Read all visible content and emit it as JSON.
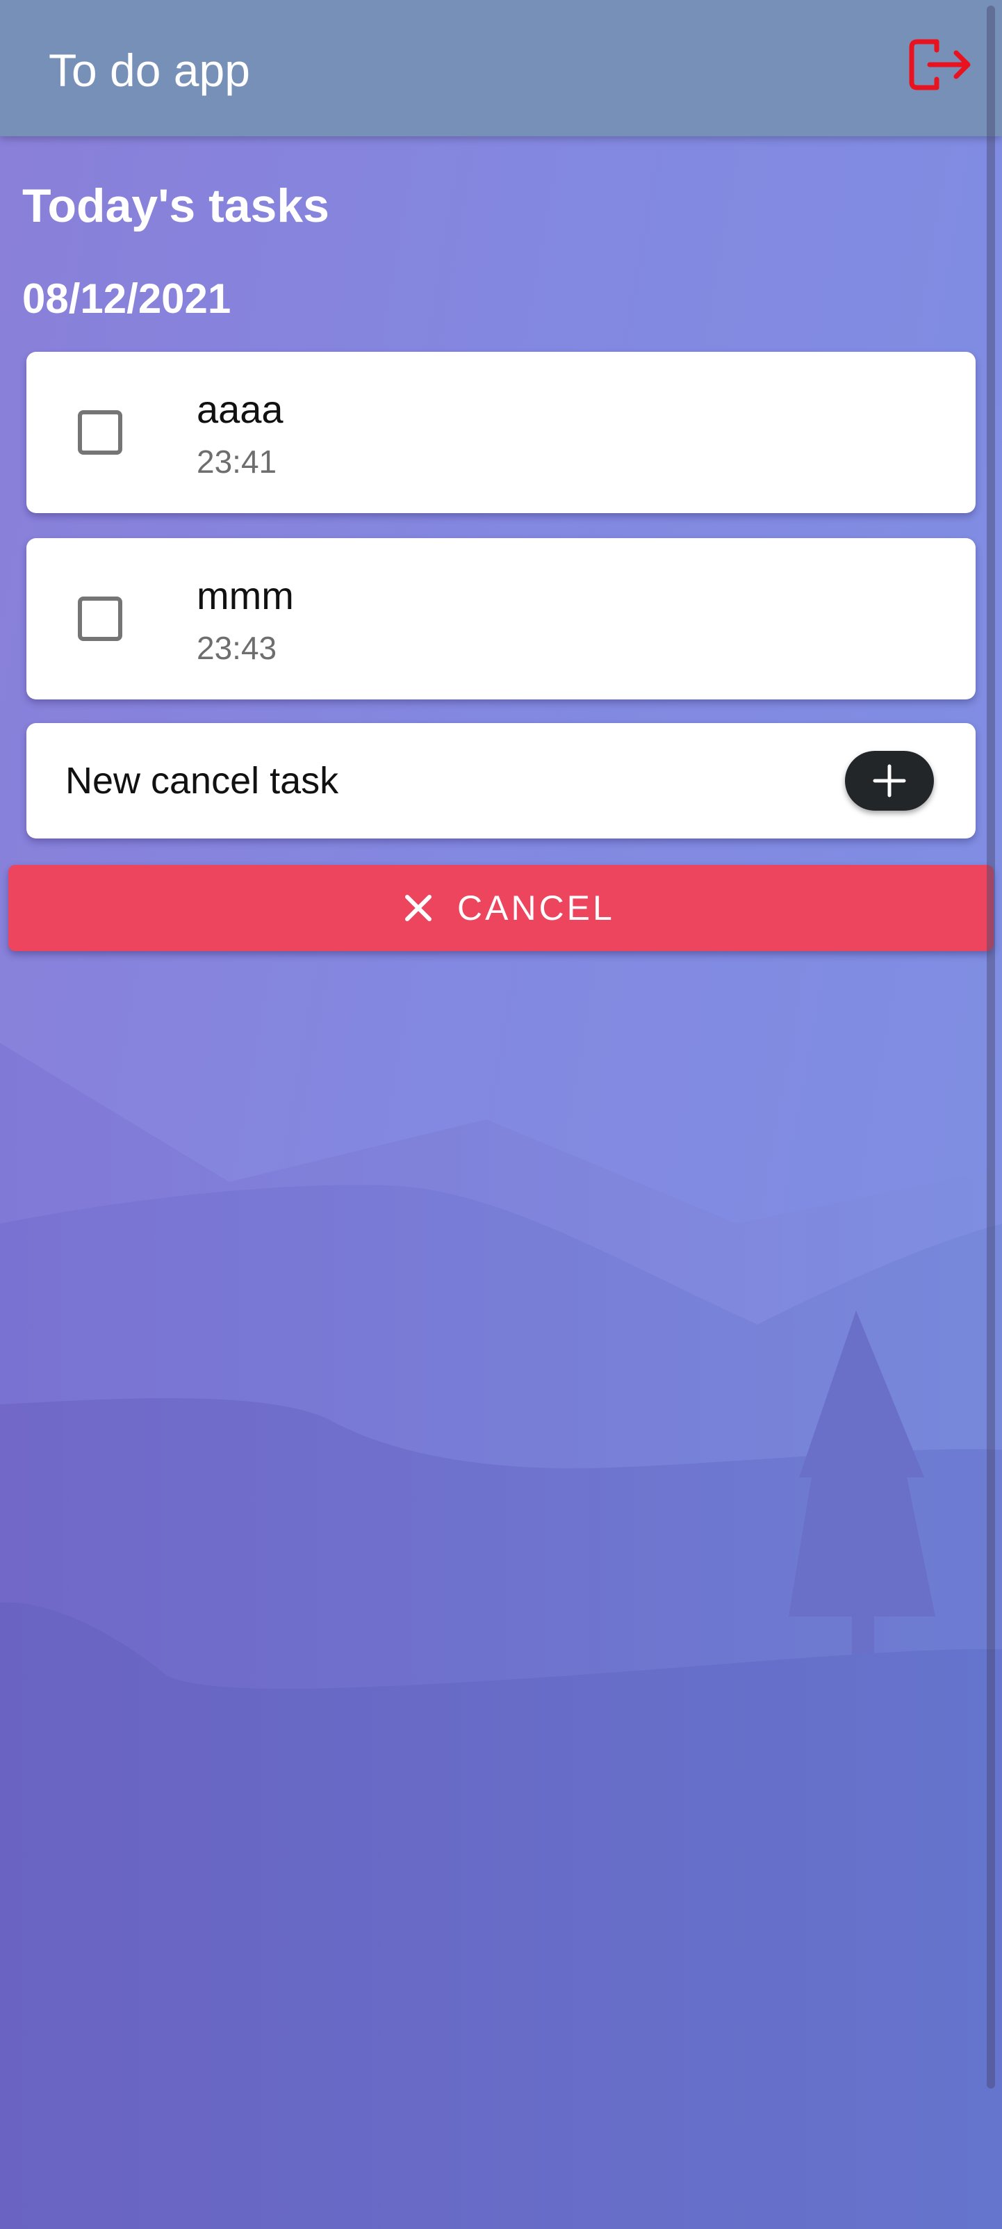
{
  "colors": {
    "app_bar": "#7790b8",
    "background_top": "#8a7fd9",
    "background_bottom": "#6570c8",
    "cancel_button": "#ec455d",
    "add_button": "#232629",
    "logout_icon": "#e8131f"
  },
  "header": {
    "title": "To do app",
    "logout_icon": "logout-icon"
  },
  "page": {
    "heading": "Today's tasks",
    "date": "08/12/2021"
  },
  "tasks": [
    {
      "title": "aaaa",
      "time": "23:41",
      "checked": false
    },
    {
      "title": "mmm",
      "time": "23:43",
      "checked": false
    }
  ],
  "new_task": {
    "placeholder": "New cancel task",
    "add_icon": "plus-icon"
  },
  "cancel_button": {
    "label": "CANCEL",
    "icon": "close-icon"
  }
}
